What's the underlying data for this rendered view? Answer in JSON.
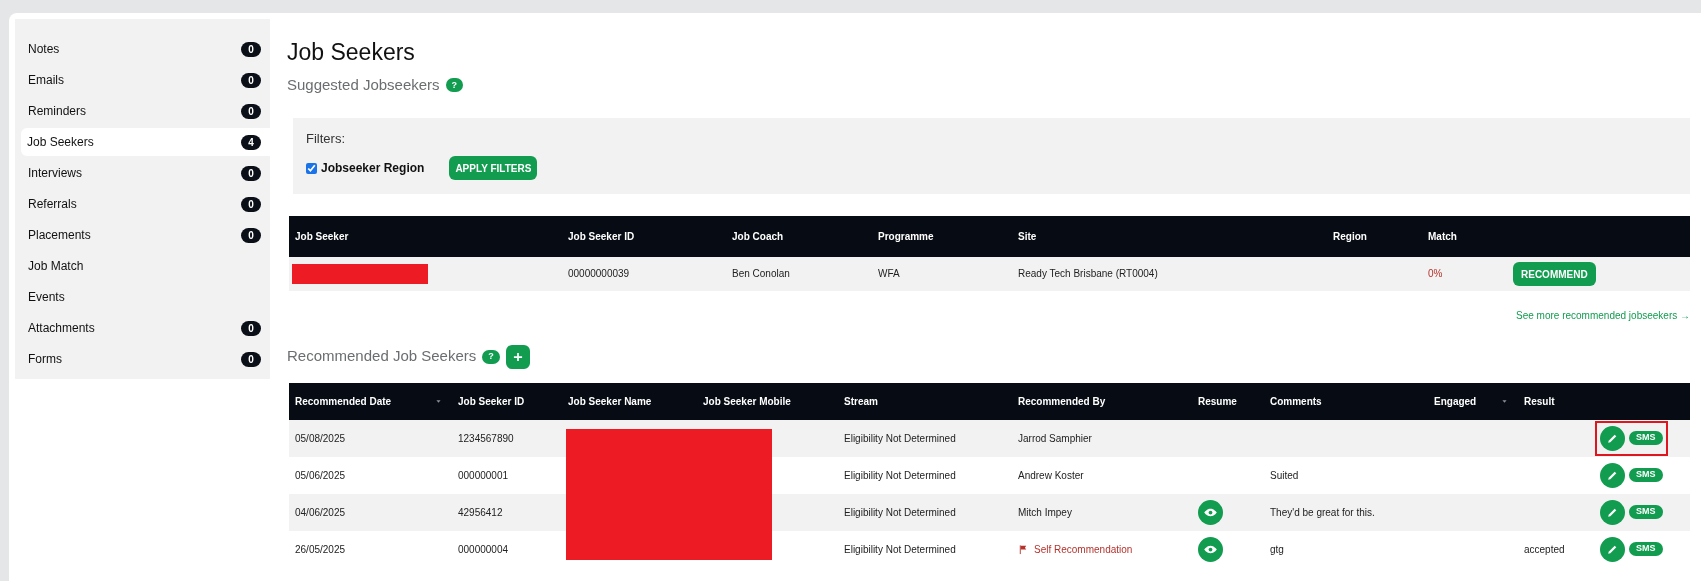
{
  "sidebar": {
    "items": [
      {
        "label": "Notes",
        "count": "0",
        "selected": false
      },
      {
        "label": "Emails",
        "count": "0",
        "selected": false
      },
      {
        "label": "Reminders",
        "count": "0",
        "selected": false
      },
      {
        "label": "Job Seekers",
        "count": "4",
        "selected": true
      },
      {
        "label": "Interviews",
        "count": "0",
        "selected": false
      },
      {
        "label": "Referrals",
        "count": "0",
        "selected": false
      },
      {
        "label": "Placements",
        "count": "0",
        "selected": false
      },
      {
        "label": "Job Match",
        "selected": false
      },
      {
        "label": "Events",
        "selected": false
      },
      {
        "label": "Attachments",
        "count": "0",
        "selected": false
      },
      {
        "label": "Forms",
        "count": "0",
        "selected": false
      }
    ]
  },
  "page_title": "Job Seekers",
  "suggested": {
    "title": "Suggested Jobseekers",
    "help": "?",
    "filters": {
      "title": "Filters:",
      "options": [
        {
          "label": "Jobseeker Region",
          "checked": true
        }
      ],
      "apply_button": "APPLY FILTERS"
    },
    "table": {
      "columns": [
        "Job Seeker",
        "Job Seeker ID",
        "Job Coach",
        "Programme",
        "Site",
        "Region",
        "Match"
      ],
      "rows": [
        {
          "job_seeker_redacted": true,
          "job_seeker_id": "00000000039",
          "job_coach": "Ben Conolan",
          "programme": "WFA",
          "site": "Ready Tech Brisbane (RT0004)",
          "match": "0%",
          "action": "RECOMMEND"
        }
      ]
    },
    "see_more_link": "See more recommended jobseekers →"
  },
  "recommended": {
    "title": "Recommended Job Seekers",
    "help": "?",
    "names_redacted": true,
    "table": {
      "columns": [
        {
          "label": "Recommended Date",
          "sortable": true
        },
        {
          "label": "Job Seeker ID",
          "sortable": false
        },
        {
          "label": "Job Seeker Name",
          "sortable": false
        },
        {
          "label": "Job Seeker Mobile",
          "sortable": false
        },
        {
          "label": "Stream",
          "sortable": false
        },
        {
          "label": "Recommended By",
          "sortable": false
        },
        {
          "label": "Resume",
          "sortable": false
        },
        {
          "label": "Comments",
          "sortable": false
        },
        {
          "label": "Engaged",
          "sortable": true
        },
        {
          "label": "Result",
          "sortable": false
        }
      ],
      "rows": [
        {
          "date": "05/08/2025",
          "job_seeker_id": "1234567890",
          "stream": "Eligibility Not Determined",
          "recommended_by": "Jarrod Samphier",
          "self_recommendation": false,
          "has_resume": false,
          "sms": "SMS",
          "highlighted": true
        },
        {
          "date": "05/06/2025",
          "job_seeker_id": "000000001",
          "stream": "Eligibility Not Determined",
          "recommended_by": "Andrew Koster",
          "self_recommendation": false,
          "has_resume": false,
          "comments": "Suited",
          "sms": "SMS",
          "highlighted": false
        },
        {
          "date": "04/06/2025",
          "job_seeker_id": "42956412",
          "stream": "Eligibility Not Determined",
          "recommended_by": "Mitch Impey",
          "self_recommendation": false,
          "has_resume": true,
          "comments": "They'd be great for this.",
          "sms": "SMS",
          "highlighted": false
        },
        {
          "date": "26/05/2025",
          "job_seeker_id": "000000004",
          "stream": "Eligibility Not Determined",
          "recommended_by": "Self Recommendation",
          "self_recommendation": true,
          "has_resume": true,
          "comments": "gtg",
          "result": "accepted",
          "sms": "SMS",
          "highlighted": false
        }
      ]
    }
  }
}
